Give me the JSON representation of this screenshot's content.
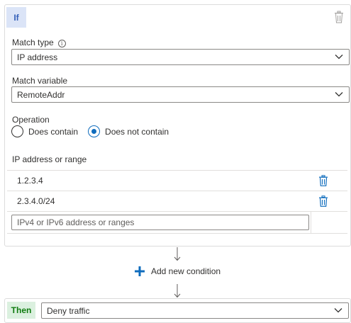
{
  "if_block": {
    "badge": "If",
    "match_type": {
      "label": "Match type",
      "info_glyph": "i",
      "value": "IP address"
    },
    "match_variable": {
      "label": "Match variable",
      "value": "RemoteAddr"
    },
    "operation": {
      "label": "Operation",
      "options": [
        {
          "label": "Does contain",
          "checked": false
        },
        {
          "label": "Does not contain",
          "checked": true
        }
      ]
    },
    "ip_section": {
      "label": "IP address or range",
      "entries": [
        "1.2.3.4",
        "2.3.4.0/24"
      ],
      "input_value": "",
      "input_placeholder": "IPv4 or IPv6 address or ranges"
    }
  },
  "add_condition_label": "Add new condition",
  "then_block": {
    "badge": "Then",
    "action_value": "Deny traffic"
  },
  "colors": {
    "accent": "#0f6cbd",
    "if_badge_bg": "#dbe4f7",
    "then_badge_bg": "#dbf0df",
    "then_badge_text": "#107c10",
    "delete_icon": "#0f6cbd"
  },
  "icons": {
    "delete": "trash-icon",
    "dropdown": "chevron-down-icon",
    "add": "plus-icon",
    "flow": "arrow-down-icon",
    "info": "info-icon"
  }
}
